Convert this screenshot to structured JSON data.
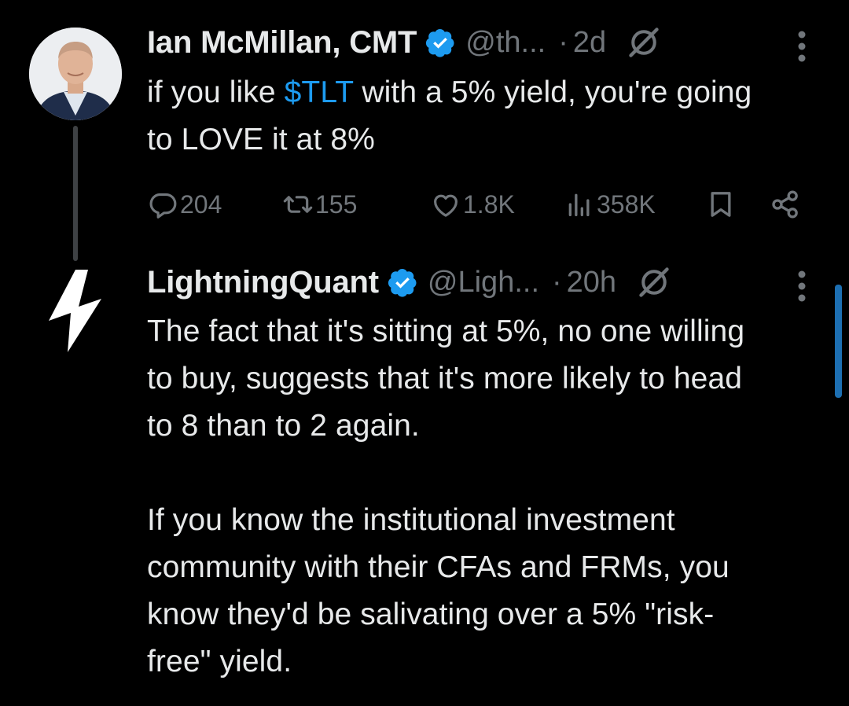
{
  "tweet1": {
    "name": "Ian McMillan, CMT",
    "handle": "@th...",
    "dot": "·",
    "time": "2d",
    "text_before": "if you like ",
    "cashtag": "$TLT",
    "text_after": " with a 5% yield, you're going to LOVE it at 8%",
    "actions": {
      "replies": "204",
      "reposts": "155",
      "likes": "1.8K",
      "views": "358K"
    }
  },
  "tweet2": {
    "name": "LightningQuant",
    "handle": "@Ligh...",
    "dot": "·",
    "time": "20h",
    "paragraph1": "The fact that it's sitting at 5%, no one willing to buy, suggests that it's more likely to head to 8 than to 2 again.",
    "paragraph2": "If you know the institutional investment community with their CFAs and FRMs, you know they'd be salivating over a 5% \"risk-free\" yield."
  },
  "colors": {
    "background": "#000000",
    "text": "#e7e9ea",
    "muted": "#71767b",
    "accent": "#1d9bf0",
    "thread_line": "#3e4144"
  },
  "icons": [
    "verified-badge-icon",
    "grok-icon",
    "more-icon",
    "reply-icon",
    "repost-icon",
    "like-icon",
    "views-icon",
    "bookmark-icon",
    "share-icon",
    "lightning-bolt-icon"
  ]
}
